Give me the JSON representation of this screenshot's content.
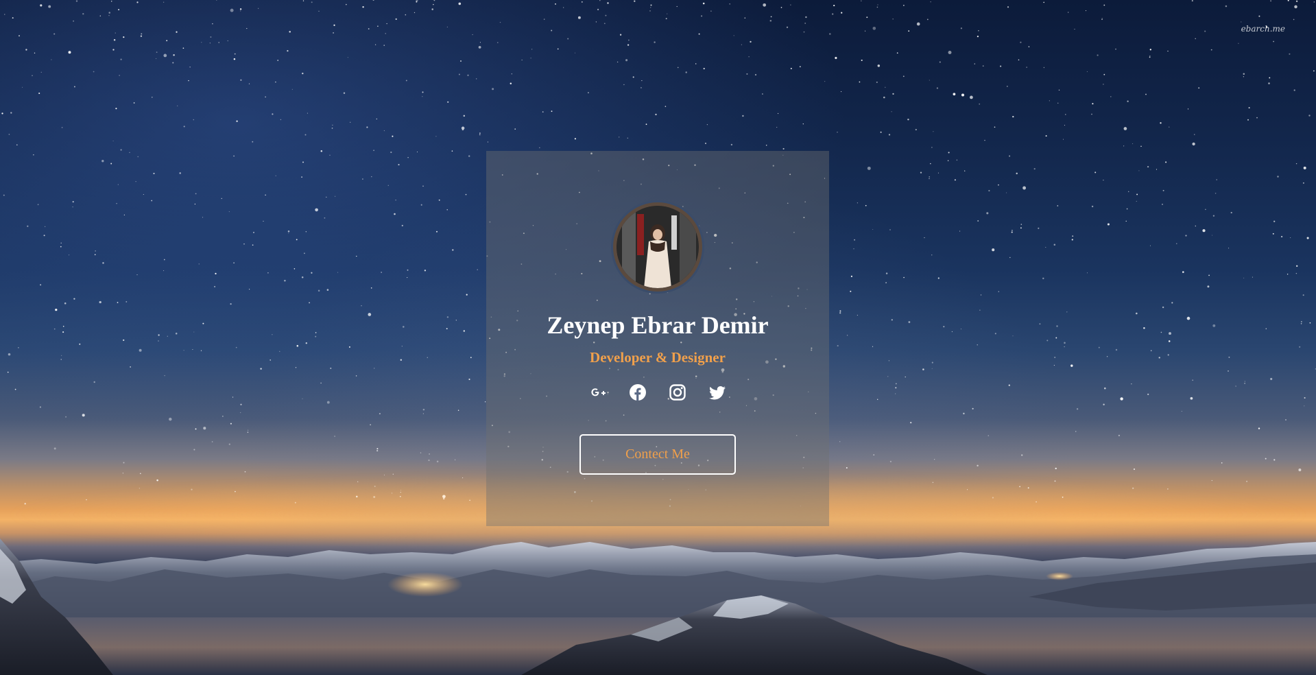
{
  "watermark": "ebarch.me",
  "profile": {
    "name": "Zeynep Ebrar Demir",
    "role": "Developer & Designer"
  },
  "socials": [
    {
      "icon": "google-plus-icon"
    },
    {
      "icon": "facebook-icon"
    },
    {
      "icon": "instagram-icon"
    },
    {
      "icon": "twitter-icon"
    }
  ],
  "contact": {
    "label": "Contect Me"
  },
  "colors": {
    "accent": "#f0a04b",
    "text": "#ffffff",
    "card": "rgba(112,112,112,0.42)"
  }
}
